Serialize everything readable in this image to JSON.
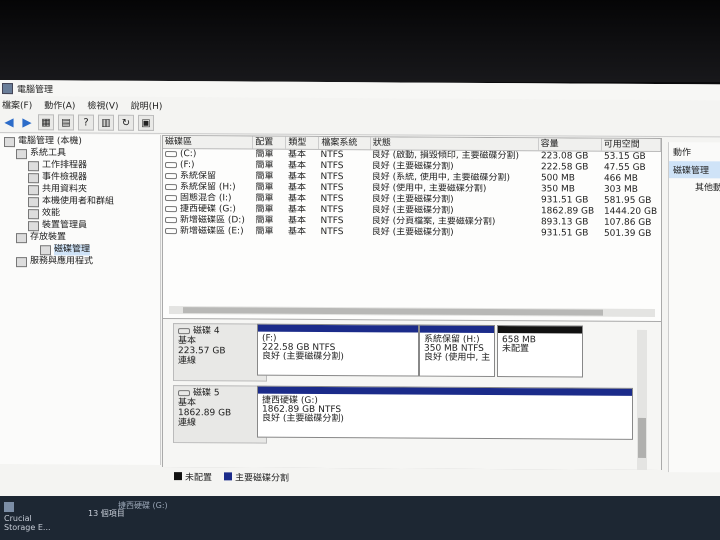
{
  "window": {
    "title": "電腦管理"
  },
  "menu": [
    "檔案(F)",
    "動作(A)",
    "檢視(V)",
    "說明(H)"
  ],
  "tree": [
    {
      "label": "電腦管理 (本機)",
      "level": 0,
      "icon": "computer-icon"
    },
    {
      "label": "系統工具",
      "level": 1,
      "icon": "tools-icon"
    },
    {
      "label": "工作排程器",
      "level": 2,
      "icon": "clock-icon"
    },
    {
      "label": "事件檢視器",
      "level": 2,
      "icon": "event-icon"
    },
    {
      "label": "共用資料夾",
      "level": 2,
      "icon": "folder-icon"
    },
    {
      "label": "本機使用者和群組",
      "level": 2,
      "icon": "users-icon"
    },
    {
      "label": "效能",
      "level": 2,
      "icon": "performance-icon"
    },
    {
      "label": "裝置管理員",
      "level": 2,
      "icon": "device-icon"
    },
    {
      "label": "存放裝置",
      "level": 1,
      "icon": "storage-icon"
    },
    {
      "label": "磁碟管理",
      "level": 2,
      "icon": "disk-icon",
      "selected": true
    },
    {
      "label": "服務與應用程式",
      "level": 1,
      "icon": "services-icon"
    }
  ],
  "volumes": {
    "headers": [
      "磁碟區",
      "配置",
      "類型",
      "檔案系統",
      "狀態",
      "容量",
      "可用空間"
    ],
    "rows": [
      [
        "(C:)",
        "簡單",
        "基本",
        "NTFS",
        "良好 (啟動, 損毀傾印, 主要磁碟分割)",
        "223.08 GB",
        "53.15 GB"
      ],
      [
        "(F:)",
        "簡單",
        "基本",
        "NTFS",
        "良好 (主要磁碟分割)",
        "222.58 GB",
        "47.55 GB"
      ],
      [
        "系統保留",
        "簡單",
        "基本",
        "NTFS",
        "良好 (系統, 使用中, 主要磁碟分割)",
        "500 MB",
        "466 MB"
      ],
      [
        "系統保留 (H:)",
        "簡單",
        "基本",
        "NTFS",
        "良好 (使用中, 主要磁碟分割)",
        "350 MB",
        "303 MB"
      ],
      [
        "固態混合 (I:)",
        "簡單",
        "基本",
        "NTFS",
        "良好 (主要磁碟分割)",
        "931.51 GB",
        "581.95 GB"
      ],
      [
        "捷西硬碟 (G:)",
        "簡單",
        "基本",
        "NTFS",
        "良好 (主要磁碟分割)",
        "1862.89 GB",
        "1444.20 GB"
      ],
      [
        "新增磁碟區 (D:)",
        "簡單",
        "基本",
        "NTFS",
        "良好 (分頁檔案, 主要磁碟分割)",
        "893.13 GB",
        "107.86 GB"
      ],
      [
        "新增磁碟區 (E:)",
        "簡單",
        "基本",
        "NTFS",
        "良好 (主要磁碟分割)",
        "931.51 GB",
        "501.39 GB"
      ]
    ]
  },
  "disks": [
    {
      "name": "磁碟 4",
      "type": "基本",
      "size": "223.57 GB",
      "status": "連線",
      "partitions": [
        {
          "title": "(F:)",
          "line1": "222.58 GB NTFS",
          "line2": "良好 (主要磁碟分割)",
          "color": "#1b2b8a"
        },
        {
          "title": "系統保留 (H:)",
          "line1": "350 MB NTFS",
          "line2": "良好 (使用中, 主",
          "color": "#1b2b8a"
        },
        {
          "title": "",
          "line1": "658 MB",
          "line2": "未配置",
          "color": "#111111"
        }
      ]
    },
    {
      "name": "磁碟 5",
      "type": "基本",
      "size": "1862.89 GB",
      "status": "連線",
      "partitions": [
        {
          "title": "捷西硬碟 (G:)",
          "line1": "1862.89 GB NTFS",
          "line2": "良好 (主要磁碟分割)",
          "color": "#1b2b8a"
        }
      ]
    }
  ],
  "legend": [
    {
      "label": "未配置",
      "color": "#111111"
    },
    {
      "label": "主要磁碟分割",
      "color": "#1b2b8a"
    }
  ],
  "actions": {
    "title": "動作",
    "selected": "磁碟管理",
    "sub": "其他動作"
  },
  "taskbar": {
    "item_line1": "Crucial",
    "item_line2": "Storage E...",
    "file_label": "捷西硬碟 (G:)",
    "count": "13 個項目"
  }
}
